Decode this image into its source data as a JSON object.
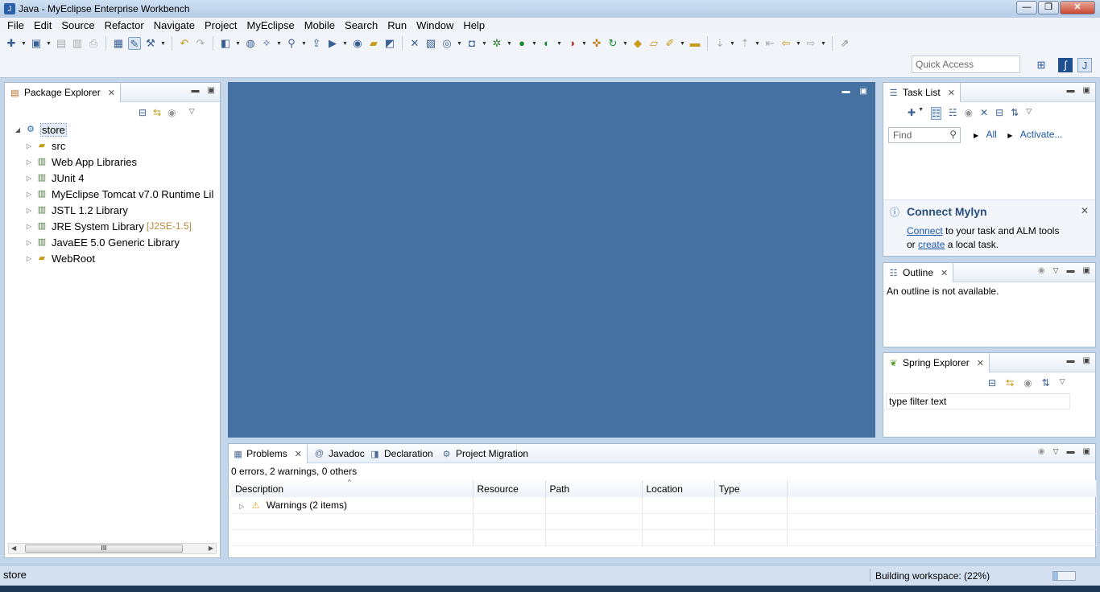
{
  "window": {
    "title": "Java - MyEclipse Enterprise Workbench",
    "minimize_glyph": "—",
    "restore_glyph": "❐",
    "close_glyph": "✕"
  },
  "menu": [
    "File",
    "Edit",
    "Source",
    "Refactor",
    "Navigate",
    "Project",
    "MyEclipse",
    "Mobile",
    "Search",
    "Run",
    "Window",
    "Help"
  ],
  "quick_access": {
    "placeholder": "Quick Access"
  },
  "package_explorer": {
    "tab_label": "Package Explorer",
    "project": "store",
    "children": [
      {
        "label": "src",
        "suffix": ""
      },
      {
        "label": "Web App Libraries",
        "suffix": ""
      },
      {
        "label": "JUnit 4",
        "suffix": ""
      },
      {
        "label": "MyEclipse Tomcat v7.0 Runtime Lil",
        "suffix": ""
      },
      {
        "label": "JSTL 1.2 Library",
        "suffix": ""
      },
      {
        "label": "JRE System Library",
        "suffix": "[J2SE-1.5]"
      },
      {
        "label": "JavaEE 5.0 Generic Library",
        "suffix": ""
      },
      {
        "label": "WebRoot",
        "suffix": ""
      }
    ],
    "scroll_thumb_label": "III"
  },
  "task_list": {
    "tab_label": "Task List",
    "find_placeholder": "Find",
    "filter_all": "All",
    "activate": "Activate...",
    "mylyn": {
      "title": "Connect Mylyn",
      "connect_link": "Connect",
      "text1": " to your task and ALM tools",
      "text2": "or ",
      "create_link": "create",
      "text3": " a local task."
    }
  },
  "outline": {
    "tab_label": "Outline",
    "message": "An outline is not available."
  },
  "spring_explorer": {
    "tab_label": "Spring Explorer",
    "filter_placeholder": "type filter text"
  },
  "problems": {
    "tabs": [
      "Problems",
      "Javadoc",
      "Declaration",
      "Project Migration"
    ],
    "summary": "0 errors, 2 warnings, 0 others",
    "columns": [
      "Description",
      "Resource",
      "Path",
      "Location",
      "Type"
    ],
    "rows": [
      {
        "description": "Warnings (2 items)"
      }
    ]
  },
  "status": {
    "left": "store",
    "right": "Building workspace: (22%)",
    "progress": 0.22
  }
}
